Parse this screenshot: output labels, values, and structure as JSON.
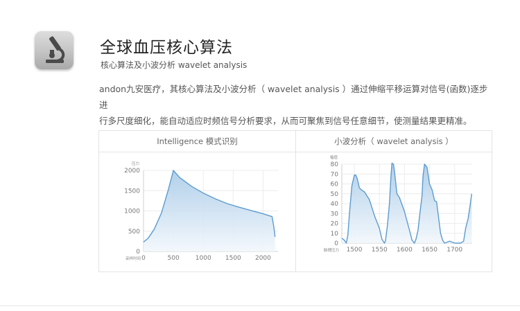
{
  "icon": {
    "name": "microscope-icon"
  },
  "header": {
    "title": "全球血压核心算法",
    "subtitle": "核心算法及小波分析 wavelet analysis"
  },
  "description": {
    "line1": "andon九安医疗，其核心算法及小波分析（ wavelet analysis ）通过伸缩平移运算对信号(函数)逐步进",
    "line2": "行多尺度细化，能自动适应时频信号分析要求，从而可聚焦到信号任意细节，使测量结果更精准。"
  },
  "colors": {
    "line": "#5b9bd0",
    "fill_top": "#a9cbe8",
    "fill_bottom": "#f2f7fc",
    "grid": "#ececec"
  },
  "chart_data": [
    {
      "type": "area",
      "panel_title": "Intelligence 模式识别",
      "ylabel": "压力",
      "xlabel": "采样时间",
      "xlim": [
        0,
        2250
      ],
      "ylim": [
        0,
        2000
      ],
      "x_ticks": [
        0,
        500,
        1000,
        1500,
        2000
      ],
      "y_ticks": [
        0,
        500,
        1000,
        1500,
        2000
      ],
      "x": [
        0,
        80,
        180,
        300,
        420,
        500,
        600,
        800,
        1000,
        1200,
        1400,
        1600,
        1800,
        2000,
        2150,
        2180,
        2200
      ],
      "y": [
        230,
        330,
        550,
        950,
        1550,
        2000,
        1830,
        1610,
        1440,
        1300,
        1180,
        1090,
        1010,
        930,
        860,
        600,
        360
      ],
      "grid": true
    },
    {
      "type": "area",
      "panel_title": "小波分析（ wavelet analysis ）",
      "ylabel": "幅值",
      "xlabel": "脉搏压力",
      "xlim": [
        1475,
        1735
      ],
      "ylim": [
        0,
        80
      ],
      "x_ticks": [
        1500,
        1550,
        1600,
        1650,
        1700
      ],
      "y_ticks": [
        0,
        10,
        20,
        30,
        40,
        50,
        60,
        70,
        80
      ],
      "x": [
        1475,
        1480,
        1484,
        1487,
        1490,
        1495,
        1500,
        1503,
        1506,
        1510,
        1514,
        1520,
        1530,
        1540,
        1550,
        1555,
        1560,
        1562,
        1566,
        1570,
        1573,
        1575,
        1578,
        1580,
        1585,
        1590,
        1600,
        1610,
        1615,
        1620,
        1623,
        1627,
        1630,
        1635,
        1637,
        1640,
        1645,
        1650,
        1655,
        1660,
        1664,
        1667,
        1670,
        1672,
        1676,
        1680,
        1685,
        1690,
        1695,
        1700,
        1705,
        1712,
        1718,
        1722,
        1727,
        1730,
        1734
      ],
      "y": [
        5,
        3,
        0,
        8,
        28,
        58,
        69,
        69,
        65,
        56,
        54,
        52,
        44,
        28,
        15,
        4,
        0,
        2,
        18,
        40,
        68,
        81,
        80,
        73,
        50,
        46,
        32,
        13,
        3,
        0,
        4,
        13,
        27,
        48,
        68,
        80,
        77,
        60,
        54,
        43,
        42,
        30,
        18,
        10,
        3,
        0,
        1,
        2,
        1,
        0,
        0,
        0,
        2,
        15,
        25,
        35,
        50
      ],
      "grid": true
    }
  ]
}
